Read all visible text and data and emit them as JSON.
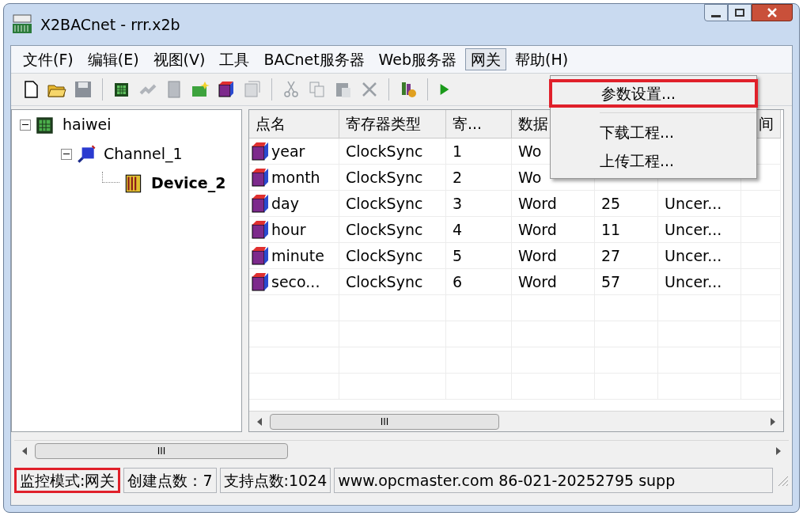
{
  "window": {
    "title": "X2BACnet - rrr.x2b"
  },
  "menu_bar": [
    {
      "label": "文件(F)",
      "selected": false
    },
    {
      "label": "编辑(E)",
      "selected": false
    },
    {
      "label": "视图(V)",
      "selected": false
    },
    {
      "label": "工具",
      "selected": false
    },
    {
      "label": "BACnet服务器",
      "selected": false
    },
    {
      "label": "Web服务器",
      "selected": false
    },
    {
      "label": "网关",
      "selected": true
    },
    {
      "label": "帮助(H)",
      "selected": false
    }
  ],
  "dropdown": [
    {
      "label": "参数设置...",
      "highlighted": true
    },
    {
      "label": "下载工程...",
      "highlighted": false
    },
    {
      "label": "上传工程...",
      "highlighted": false
    }
  ],
  "tree": [
    {
      "label": "haiwei",
      "selected": false,
      "expanded": true,
      "children": [
        {
          "label": "Channel_1",
          "selected": false,
          "expanded": true,
          "children": [
            {
              "label": "Device_2",
              "selected": true
            }
          ]
        }
      ]
    }
  ],
  "table": {
    "columns": [
      "点名",
      "寄存器类型",
      "寄...",
      "数据",
      "",
      "",
      "间"
    ],
    "rows": [
      [
        "year",
        "ClockSync",
        "1",
        "Wo",
        "",
        "",
        ""
      ],
      [
        "month",
        "ClockSync",
        "2",
        "Wo",
        "",
        "",
        ""
      ],
      [
        "day",
        "ClockSync",
        "3",
        "Word",
        "25",
        "Uncer...",
        ""
      ],
      [
        "hour",
        "ClockSync",
        "4",
        "Word",
        "11",
        "Uncer...",
        ""
      ],
      [
        "minute",
        "ClockSync",
        "5",
        "Word",
        "27",
        "Uncer...",
        ""
      ],
      [
        "seco...",
        "ClockSync",
        "6",
        "Word",
        "57",
        "Uncer...",
        ""
      ]
    ]
  },
  "table_scrollbar": {
    "grip": "III"
  },
  "panel_scrollbar": {
    "grip": "III"
  },
  "status_bar": [
    {
      "text": "监控模式:网关",
      "highlighted": true
    },
    {
      "text": "创建点数：7",
      "highlighted": false
    },
    {
      "text": "支持点数:1024",
      "highlighted": false
    },
    {
      "text": "www.opcmaster.com 86-021-20252795 supp",
      "highlighted": false
    }
  ]
}
